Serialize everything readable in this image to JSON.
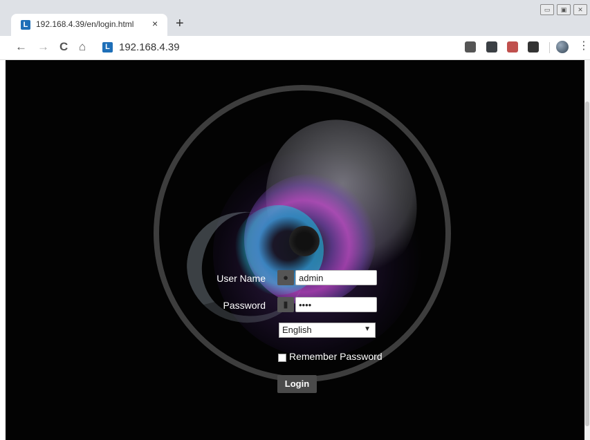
{
  "browser": {
    "tab_title": "192.168.4.39/en/login.html",
    "tab_close": "×",
    "new_tab": "+",
    "favicon_letter": "L",
    "url": "192.168.4.39",
    "nav": {
      "back": "←",
      "forward": "→",
      "reload": "C",
      "home": "⌂"
    },
    "menu": "⋮",
    "window_controls": [
      "▭",
      "▣",
      "✕"
    ],
    "extensions": [
      {
        "name": "s-extension-icon",
        "color": "#555555"
      },
      {
        "name": "tweetdeck-icon",
        "color": "#3b3f44"
      },
      {
        "name": "pdf-icon",
        "color": "#c0504d"
      },
      {
        "name": "glasses-icon",
        "color": "#333333"
      }
    ]
  },
  "login": {
    "username_label": "User Name",
    "username_value": "admin",
    "password_label": "Password",
    "password_value": "••••",
    "language_selected": "English",
    "remember_label": "Remember Password",
    "login_button": "Login"
  }
}
